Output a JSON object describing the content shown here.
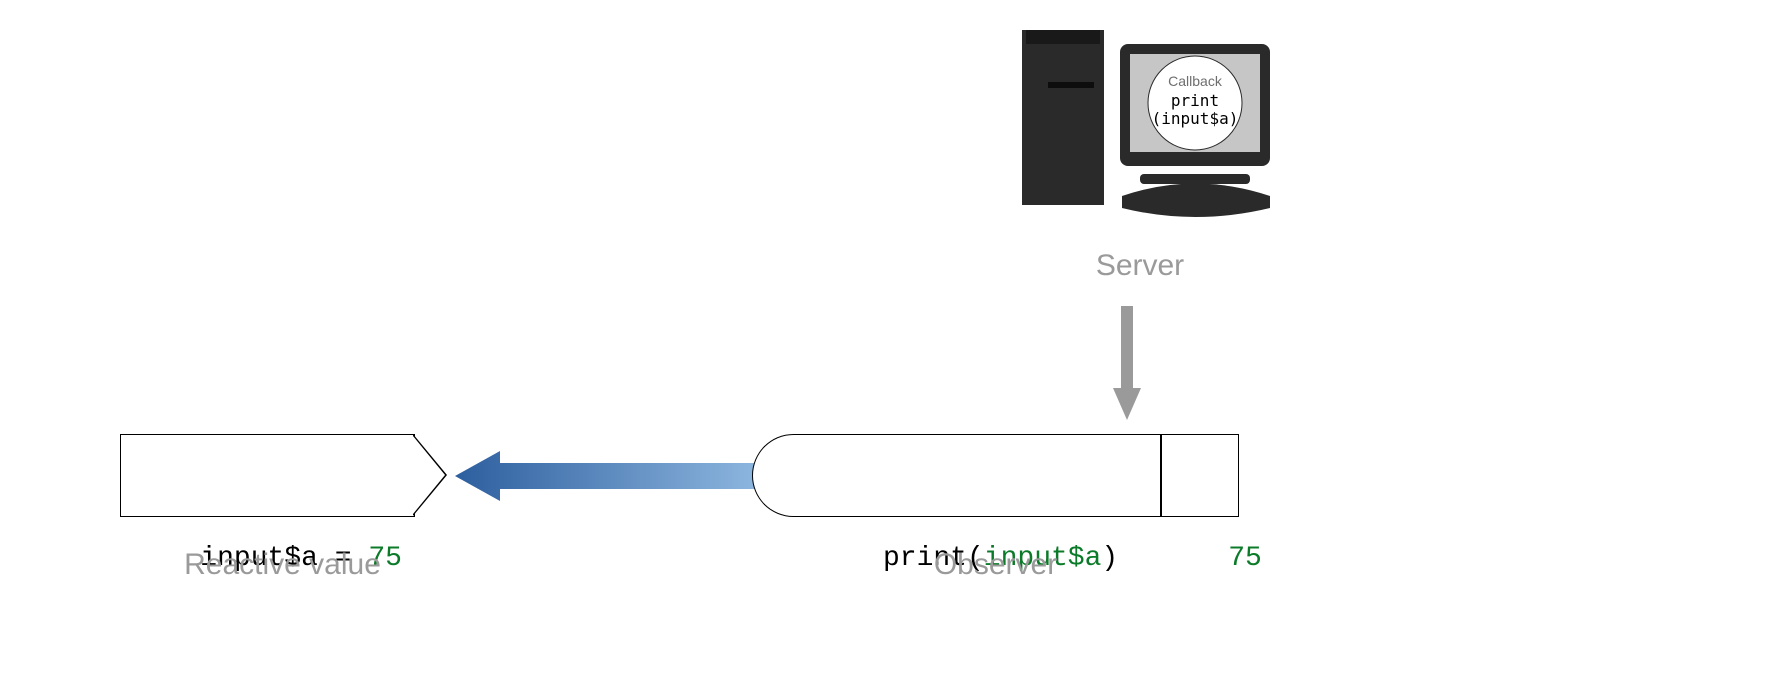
{
  "server": {
    "label": "Server",
    "screen": {
      "callback_label": "Callback",
      "code_line1": "print",
      "code_line2": "(input$a)"
    }
  },
  "reactive": {
    "expr_prefix": "input$a = ",
    "expr_value": "75",
    "caption": "Reactive value"
  },
  "observer": {
    "expr_prefix": "print(",
    "expr_inner": "input$a",
    "expr_suffix": ")",
    "result": "75",
    "caption": "Observer"
  },
  "colors": {
    "gray": "#9a9a9a",
    "arrow_blue_dark": "#1f4f8b",
    "arrow_blue_light": "#6ea3d6",
    "green": "#0c7b29",
    "icon_dark": "#2a2a2a",
    "icon_light": "#c6c6c6"
  }
}
